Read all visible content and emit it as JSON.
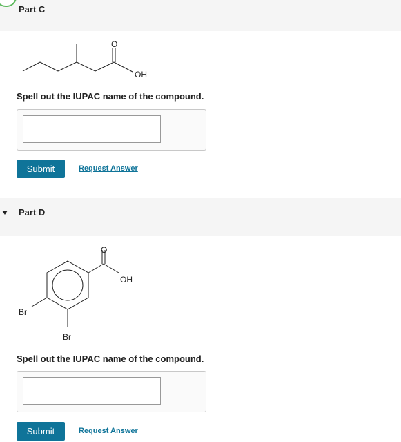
{
  "part_c": {
    "title": "Part C",
    "structure": {
      "oxygen": "O",
      "hydroxyl": "OH"
    },
    "prompt": "Spell out the IUPAC name of the compound.",
    "answer_value": "",
    "submit_label": "Submit",
    "request_label": "Request Answer"
  },
  "part_d": {
    "title": "Part D",
    "structure": {
      "oxygen": "O",
      "hydroxyl": "OH",
      "bromine_1": "Br",
      "bromine_2": "Br"
    },
    "prompt": "Spell out the IUPAC name of the compound.",
    "answer_value": "",
    "submit_label": "Submit",
    "request_label": "Request Answer"
  },
  "colors": {
    "accent": "#0f7499",
    "header_bg": "#f5f5f5",
    "complete_badge": "#5cb85c"
  },
  "icons": {
    "completed": "check-circle-icon",
    "expand": "caret-down-icon"
  }
}
